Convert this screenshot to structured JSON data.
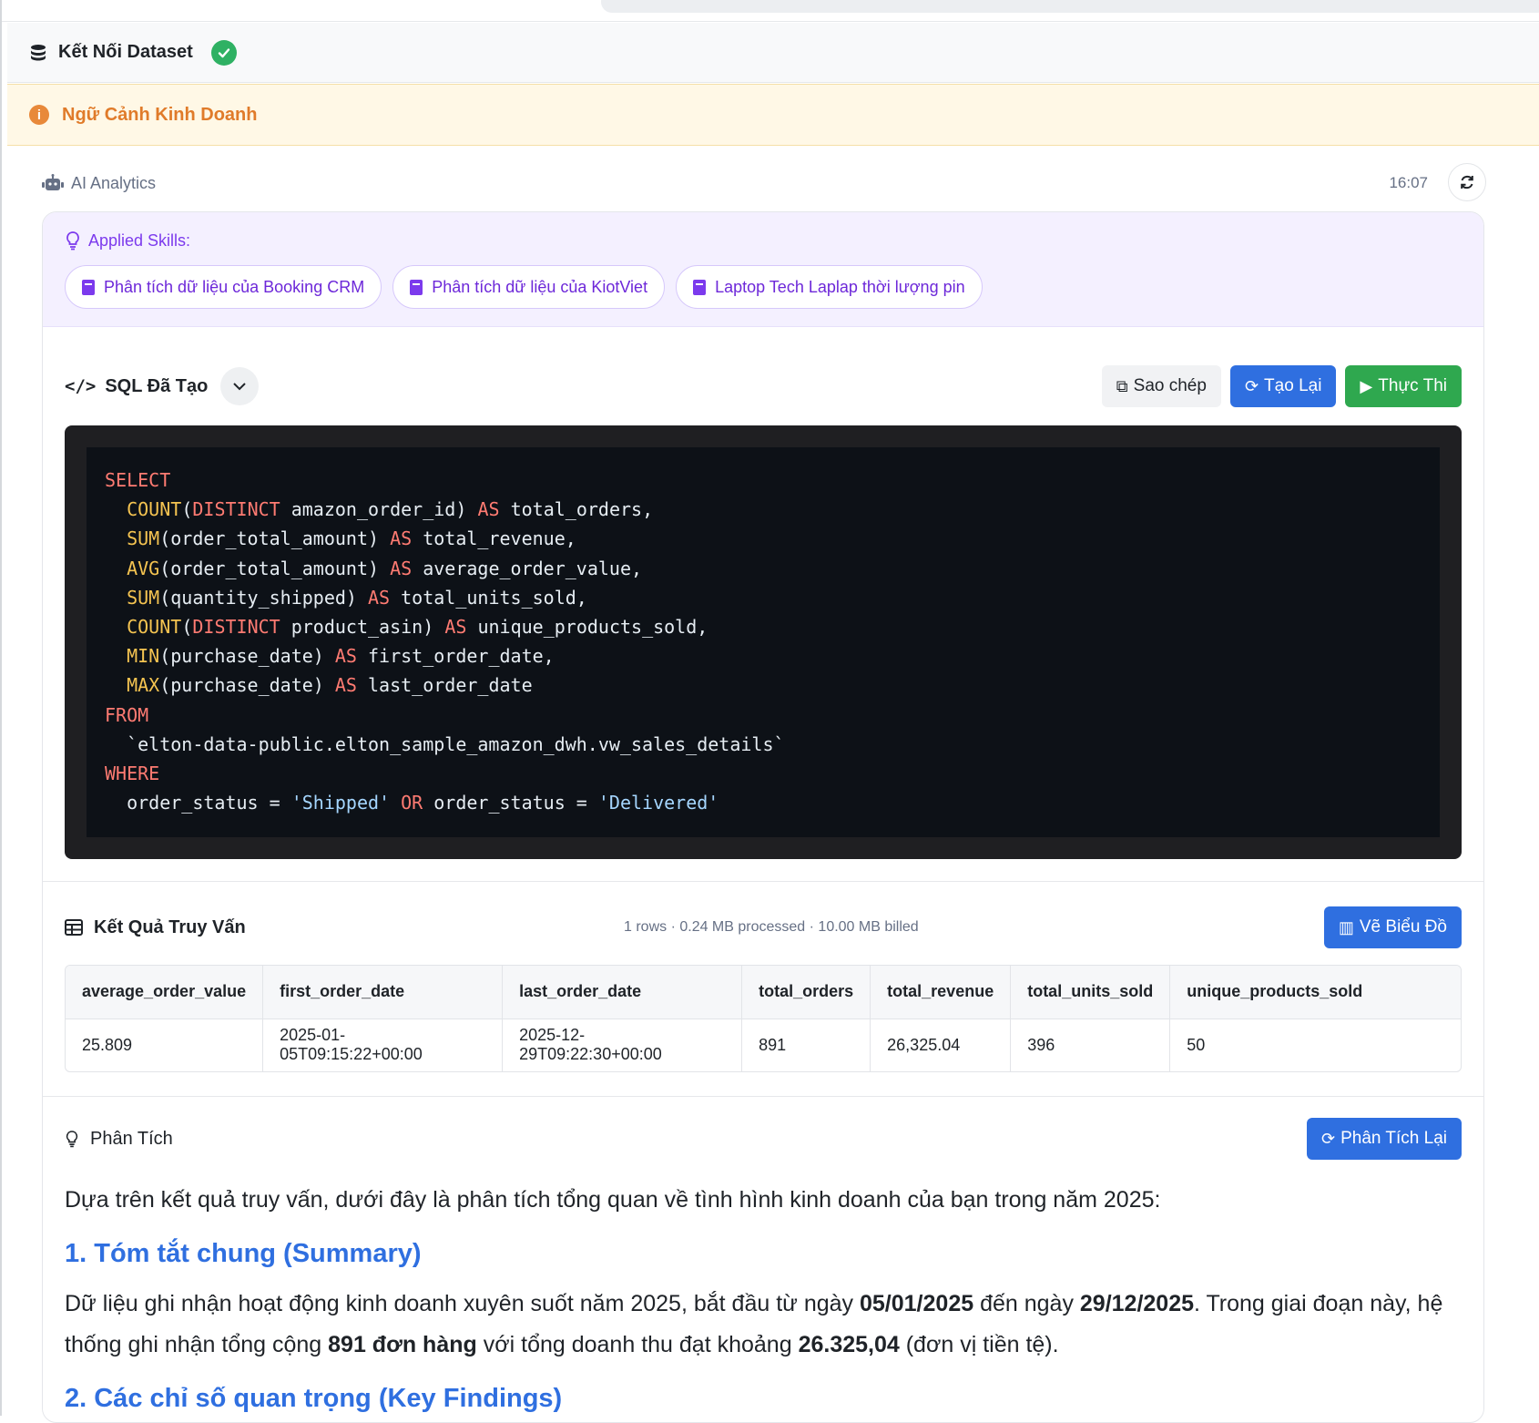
{
  "dataset": {
    "title": "Kết Nối Dataset"
  },
  "context": {
    "title": "Ngữ Cảnh Kinh Doanh"
  },
  "message": {
    "sender": "AI Analytics",
    "time": "16:07"
  },
  "skills": {
    "label": "Applied Skills:",
    "items": [
      {
        "label": "Phân tích dữ liệu của Booking CRM"
      },
      {
        "label": "Phân tích dữ liệu của KiotViet"
      },
      {
        "label": "Laptop Tech Laplap thời lượng pin"
      }
    ]
  },
  "sql": {
    "title": "SQL Đã Tạo",
    "copy_label": "Sao chép",
    "regen_label": "Tạo Lại",
    "run_label": "Thực Thi"
  },
  "results": {
    "title": "Kết Quả Truy Vấn",
    "meta": "1 rows · 0.24 MB processed · 10.00 MB billed",
    "chart_label": "Vẽ Biểu Đồ",
    "columns": [
      "average_order_value",
      "first_order_date",
      "last_order_date",
      "total_orders",
      "total_revenue",
      "total_units_sold",
      "unique_products_sold"
    ],
    "rows": [
      [
        "25.809",
        "2025-01-05T09:15:22+00:00",
        "2025-12-29T09:22:30+00:00",
        "891",
        "26,325.04",
        "396",
        "50"
      ]
    ]
  },
  "analysis": {
    "title": "Phân Tích",
    "reanalyze_label": "Phân Tích Lại",
    "intro": "Dựa trên kết quả truy vấn, dưới đây là phân tích tổng quan về tình hình kinh doanh của bạn trong năm 2025:",
    "h1": "1. Tóm tắt chung (Summary)",
    "p1_a": "Dữ liệu ghi nhận hoạt động kinh doanh xuyên suốt năm 2025, bắt đầu từ ngày ",
    "p1_b": "05/01/2025",
    "p1_c": " đến ngày ",
    "p1_d": "29/12/2025",
    "p1_e": ". Trong giai đoạn này, hệ thống ghi nhận tổng cộng ",
    "p1_f": "891 đơn hàng",
    "p1_g": " với tổng doanh thu đạt khoảng ",
    "p1_h": "26.325,04",
    "p1_i": " (đơn vị tiền tệ).",
    "h2": "2. Các chỉ số quan trọng (Key Findings)"
  },
  "colors": {
    "accent_blue": "#2f6fe0",
    "run_green": "#2fa84f",
    "skill_purple": "#7c3aed",
    "context_orange": "#e07b2a"
  }
}
